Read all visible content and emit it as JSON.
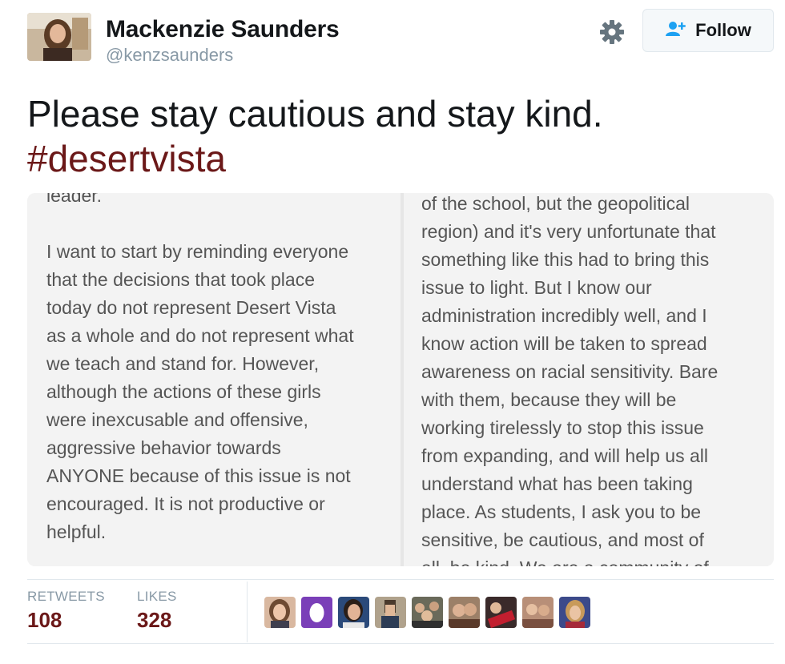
{
  "user": {
    "name": "Mackenzie Saunders",
    "handle": "@kenzsaunders"
  },
  "actions": {
    "follow_label": "Follow"
  },
  "tweet": {
    "text": "Please stay cautious and stay kind.",
    "hashtag": "#desertvista"
  },
  "image": {
    "left_page": "leader.\n\nI want to start by reminding everyone\nthat the decisions that took place\ntoday do not represent Desert Vista\nas a whole and do not represent what\nwe teach and stand for. However,\nalthough the actions of these girls\nwere inexcusable and offensive,\naggressive behavior towards\nANYONE because of this issue is not\nencouraged. It is not productive or\nhelpful.",
    "right_page": "of the school, but the geopolitical\nregion) and it's very unfortunate that\nsomething like this had to bring this\nissue to light. But I know our\nadministration incredibly well, and I\nknow action will be taken to spread\nawareness on racial sensitivity. Bare\nwith them, because they will be\nworking tirelessly to stop this issue\nfrom expanding, and will help us all\nunderstand what has been taking\nplace. As students, I ask you to be\nsensitive, be cautious, and most of\nall, be kind. We are a community of"
  },
  "stats": {
    "retweets_label": "RETWEETS",
    "retweets_value": "108",
    "likes_label": "LIKES",
    "likes_value": "328"
  },
  "colors": {
    "hashtag": "#6b1818",
    "stat_value": "#6b1818",
    "muted": "#8899a6",
    "follow_icon": "#1da1f2"
  },
  "icons": {
    "settings": "gear-icon",
    "follow": "add-user-icon"
  }
}
